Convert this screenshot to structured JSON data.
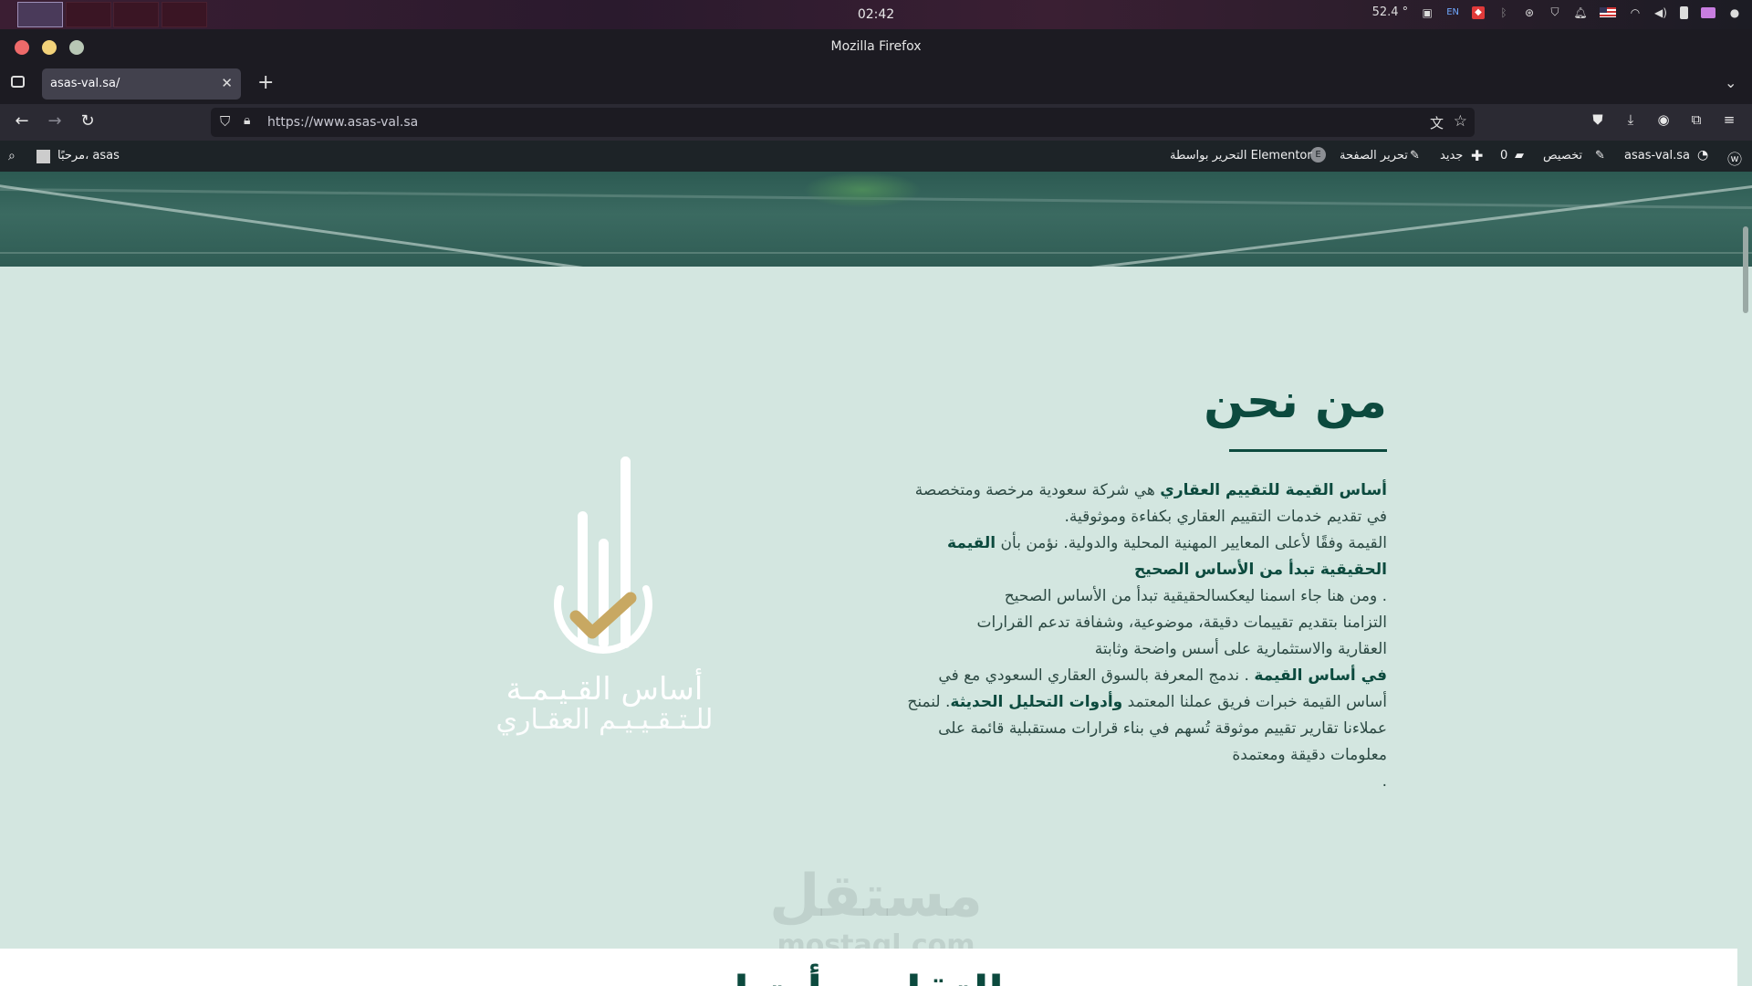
{
  "os": {
    "clock": "02:42",
    "temperature": "52.4 °",
    "keyboard_layout": "EN",
    "tray_icons": [
      "screenshot-icon",
      "keyboard-layout-icon",
      "app-indicator-icon",
      "bluetooth-icon",
      "network-status-icon",
      "shield-icon",
      "bell-icon",
      "flag-us-icon",
      "wifi-icon",
      "volume-icon",
      "battery-icon",
      "folder-icon",
      "user-icon"
    ]
  },
  "browser": {
    "window_title": "Mozilla Firefox",
    "tab_title": "asas-val.sa/",
    "url": "https://www.asas-val.sa"
  },
  "wp_admin_bar": {
    "site_name": "asas-val.sa",
    "customize": "تخصيص",
    "comments_count": "0",
    "new": "جديد",
    "edit_page": "تحرير الصفحة",
    "edit_elementor": "التحرير بواسطة Elementor",
    "greeting": "مرحبًا، asas"
  },
  "about": {
    "title": "من نحن",
    "company_name": "أساس القيمة للتقييم العقاري",
    "line1_rest": " هي شركة سعودية مرخصة ومتخصصة",
    "line2": "في تقديم خدمات التقييم العقاري بكفاءة وموثوقية.",
    "line3_plain": "القيمة وفقًا لأعلى المعايير المهنية المحلية والدولية. نؤمن بأن ",
    "line3_bold": "القيمة",
    "line4_bold": "الحقيقية تبدأ من الأساس الصحيح",
    "line5": ". ومن هنا جاء اسمنا ليعكسالحقيقية تبدأ من الأساس الصحيح",
    "line6": "التزامنا بتقديم تقييمات دقيقة، موضوعية، وشفافة تدعم القرارات",
    "line7": "العقارية والاستثمارية على أسس واضحة وثابتة",
    "line8_bold": "في أساس القيمة",
    "line8_rest": " . ندمج المعرفة بالسوق العقاري السعودي مع في",
    "line9_plain": "أساس القيمة خبرات فريق عملنا المعتمد ",
    "line9_bold": "وأدوات التحليل الحديثة",
    "line9_end": ". لنمنح",
    "line10": "عملاءنا تقارير تقييم موثوقة تُسهم في بناء قرارات مستقبلية قائمة على",
    "line11": "معلومات دقيقة ومعتمدة",
    "line12": "."
  },
  "logo": {
    "name": "أساس القـيـمـة",
    "subtitle": "للـتـقـيـيـم العقـاري",
    "accent_color": "#c8a862"
  },
  "watermark": {
    "arabic": "مستقل",
    "english": "mostaql.com"
  },
  "next_section": {
    "title": "التقارير أدتنا"
  },
  "colors": {
    "brand_green": "#0c4a3e",
    "section_bg": "#d3e6e0"
  }
}
